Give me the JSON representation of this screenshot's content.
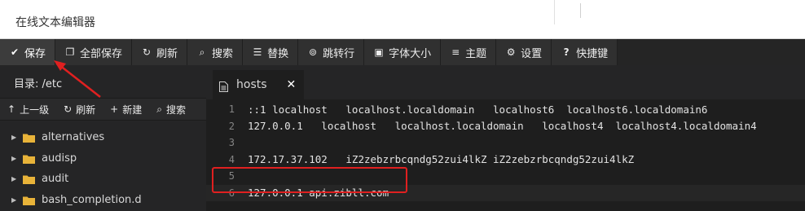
{
  "window": {
    "title": "在线文本编辑器"
  },
  "toolbar": {
    "buttons": [
      {
        "label": "保存",
        "icon": "check-icon"
      },
      {
        "label": "全部保存",
        "icon": "copy-icon"
      },
      {
        "label": "刷新",
        "icon": "refresh-icon"
      },
      {
        "label": "搜索",
        "icon": "search-icon"
      },
      {
        "label": "替换",
        "icon": "replace-icon"
      },
      {
        "label": "跳转行",
        "icon": "location-icon"
      },
      {
        "label": "字体大小",
        "icon": "font-size-icon"
      },
      {
        "label": "主题",
        "icon": "menu-icon"
      },
      {
        "label": "设置",
        "icon": "gear-icon"
      },
      {
        "label": "快捷键",
        "icon": "help-icon"
      }
    ]
  },
  "sidebar": {
    "dir_label": "目录: /etc",
    "actions": [
      {
        "label": "上一级",
        "icon": "arrow-up-icon"
      },
      {
        "label": "刷新",
        "icon": "refresh-icon"
      },
      {
        "label": "新建",
        "icon": "plus-icon"
      },
      {
        "label": "搜索",
        "icon": "search-icon"
      }
    ],
    "tree": [
      {
        "name": "alternatives"
      },
      {
        "name": "audisp"
      },
      {
        "name": "audit"
      },
      {
        "name": "bash_completion.d"
      }
    ]
  },
  "editor": {
    "tab": {
      "name": "hosts",
      "close": "✕"
    },
    "lines": [
      {
        "num": "1",
        "text": "::1 localhost   localhost.localdomain   localhost6  localhost6.localdomain6"
      },
      {
        "num": "2",
        "text": "127.0.0.1   localhost   localhost.localdomain   localhost4  localhost4.localdomain4"
      },
      {
        "num": "3",
        "text": ""
      },
      {
        "num": "4",
        "text": "172.17.37.102   iZ2zebzrbcqndg52zui4lkZ iZ2zebzrbcqndg52zui4lkZ"
      },
      {
        "num": "5",
        "text": ""
      },
      {
        "num": "6",
        "text": "127.0.0.1 api.zibll.com"
      }
    ]
  },
  "colors": {
    "toolbar_bg": "#303030",
    "sidebar_bg": "#252526",
    "editor_bg": "#1e1e1e",
    "folder": "#e8b339",
    "highlight": "#e02020"
  }
}
